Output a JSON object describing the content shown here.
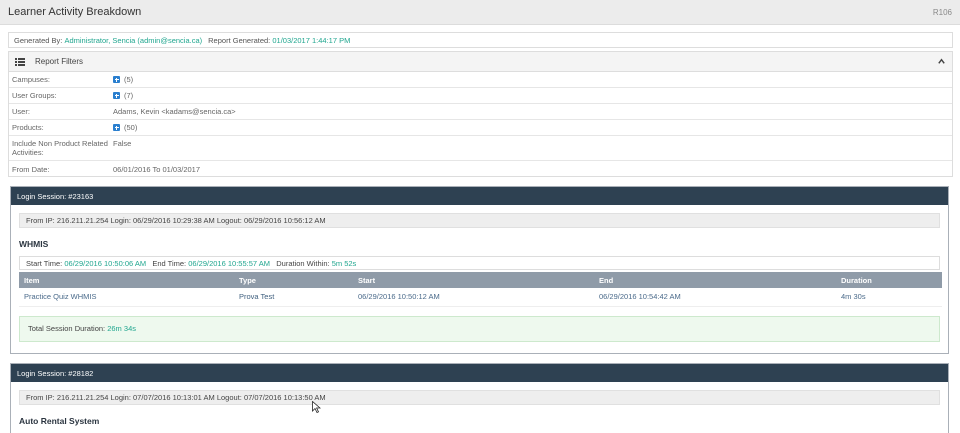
{
  "header": {
    "title": "Learner Activity Breakdown",
    "code": "R106"
  },
  "generated": {
    "by_label": "Generated By:",
    "by_value": "Administrator, Sencia (admin@sencia.ca)",
    "date_label": "Report Generated:",
    "date_value": "01/03/2017 1:44:17 PM"
  },
  "filters": {
    "title": "Report Filters",
    "rows": [
      {
        "key": "Campuses:",
        "value": "(5)"
      },
      {
        "key": "User Groups:",
        "value": "(7)"
      },
      {
        "key": "User:",
        "value": "Adams, Kevin <kadams@sencia.ca>"
      },
      {
        "key": "Products:",
        "value": "(50)"
      },
      {
        "key": "Include Non Product Related Activities:",
        "value": "False"
      },
      {
        "key": "From Date:",
        "value": "06/01/2016 To 01/03/2017"
      }
    ]
  },
  "sessions": [
    {
      "title": "Login Session: #23163",
      "ip_line": "From IP: 216.211.21.254  Login: 06/29/2016 10:29:38 AM  Logout: 06/29/2016 10:56:12 AM",
      "product": "WHMIS",
      "start_label": "Start Time:",
      "start_value": "06/29/2016 10:50:06 AM",
      "end_label": "End Time:",
      "end_value": "06/29/2016 10:55:57 AM",
      "duration_label": "Duration Within:",
      "duration_value": "5m 52s",
      "columns": [
        "Item",
        "Type",
        "Start",
        "End",
        "Duration"
      ],
      "rows": [
        [
          "Practice Quiz WHMIS",
          "Prova Test",
          "06/29/2016 10:50:12 AM",
          "06/29/2016 10:54:42 AM",
          "4m 30s"
        ]
      ],
      "total_label": "Total Session Duration:",
      "total_value": "26m 34s"
    },
    {
      "title": "Login Session: #28182",
      "ip_line": "From IP: 216.211.21.254  Login: 07/07/2016 10:13:01 AM  Logout: 07/07/2016 10:13:50 AM",
      "product": "Auto Rental System"
    }
  ],
  "icons": {
    "filters": "list-icon",
    "collapse": "chevron-up-icon",
    "expand": "plus-icon",
    "cursor": "mouse-cursor-icon"
  },
  "colors": {
    "accent": "#20a68f",
    "session_header": "#2e4152",
    "table_header": "#8f9ba8",
    "plus": "#2a7fcf"
  }
}
